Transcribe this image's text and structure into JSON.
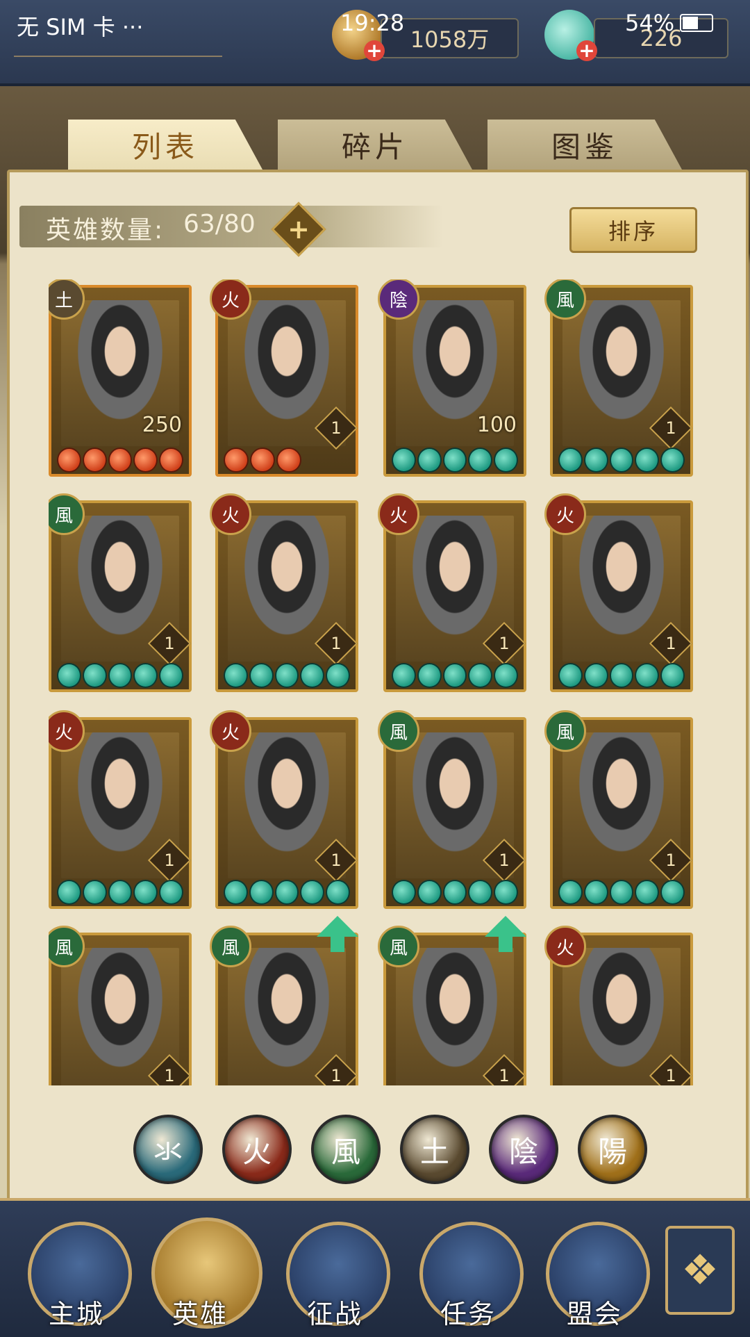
{
  "status_bar": {
    "carrier": "无 SIM 卡 ···",
    "time": "19:28",
    "battery": "54%"
  },
  "resources": {
    "coins": "1058万",
    "gems": "226"
  },
  "tabs": [
    "列表",
    "碎片",
    "图鉴"
  ],
  "hero_count": {
    "label": "英雄数量:",
    "value": "63/80"
  },
  "sort_label": "排序",
  "elements": {
    "water": {
      "glyph": "氺",
      "color": "#2a6a7a"
    },
    "fire": {
      "glyph": "火",
      "color": "#8a2a1a"
    },
    "wind": {
      "glyph": "風",
      "color": "#2a6a3a"
    },
    "earth": {
      "glyph": "土",
      "color": "#5a4a30"
    },
    "yin": {
      "glyph": "陰",
      "color": "#5a2a7a"
    },
    "yang": {
      "glyph": "陽",
      "color": "#a0701a"
    }
  },
  "heroes": [
    {
      "element": "土",
      "level": "250",
      "stars": 5,
      "star_color": "red"
    },
    {
      "element": "火",
      "level": "1",
      "stars": 3,
      "star_color": "red"
    },
    {
      "element": "陰",
      "level": "100",
      "stars": 5,
      "star_color": "green"
    },
    {
      "element": "風",
      "level": "1",
      "stars": 5,
      "star_color": "green"
    },
    {
      "element": "風",
      "level": "1",
      "stars": 5,
      "star_color": "green"
    },
    {
      "element": "火",
      "level": "1",
      "stars": 5,
      "star_color": "green"
    },
    {
      "element": "火",
      "level": "1",
      "stars": 5,
      "star_color": "green"
    },
    {
      "element": "火",
      "level": "1",
      "stars": 5,
      "star_color": "green"
    },
    {
      "element": "火",
      "level": "1",
      "stars": 5,
      "star_color": "green"
    },
    {
      "element": "火",
      "level": "1",
      "stars": 5,
      "star_color": "green"
    },
    {
      "element": "風",
      "level": "1",
      "stars": 5,
      "star_color": "green"
    },
    {
      "element": "風",
      "level": "1",
      "stars": 5,
      "star_color": "green"
    },
    {
      "element": "風",
      "level": "1",
      "stars": 0,
      "star_color": "green"
    },
    {
      "element": "風",
      "level": "1",
      "stars": 0,
      "star_color": "green",
      "upgrade": true
    },
    {
      "element": "風",
      "level": "1",
      "stars": 0,
      "star_color": "green",
      "upgrade": true
    },
    {
      "element": "火",
      "level": "1",
      "stars": 0,
      "star_color": "green"
    }
  ],
  "filters": [
    "氺",
    "火",
    "風",
    "土",
    "陰",
    "陽"
  ],
  "nav": [
    {
      "label": "主城",
      "icon": "city-gate-icon"
    },
    {
      "label": "英雄",
      "icon": "hero-avatar-icon"
    },
    {
      "label": "征战",
      "icon": "battle-horn-icon"
    },
    {
      "label": "任务",
      "icon": "task-scroll-icon"
    },
    {
      "label": "盟会",
      "icon": "guild-gate-icon"
    }
  ],
  "nav_more_icon": "menu-flower-icon"
}
